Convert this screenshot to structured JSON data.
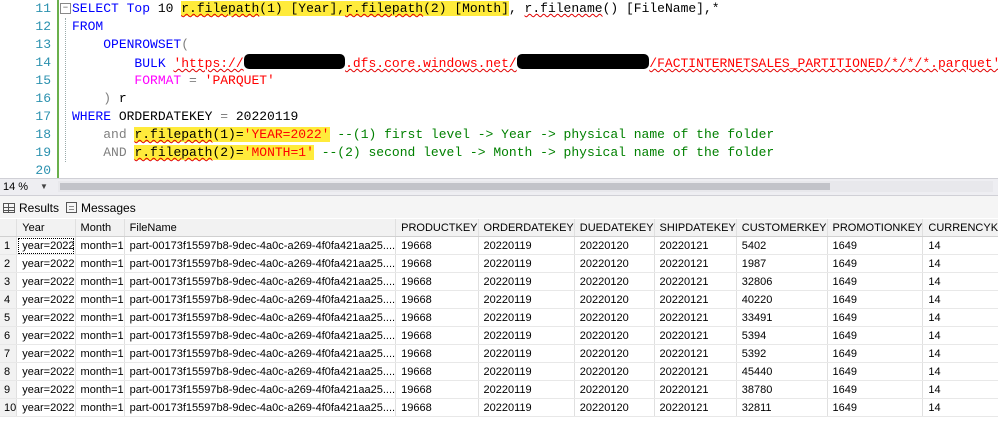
{
  "editor": {
    "lines": [
      {
        "num": "11",
        "parts": [
          {
            "t": "SELECT",
            "c": "kw"
          },
          {
            "t": " "
          },
          {
            "t": "Top",
            "c": "kw"
          },
          {
            "t": " 10 "
          },
          {
            "t": "r.filepath",
            "c": "hl sq"
          },
          {
            "t": "(1) [Year],",
            "c": "hl"
          },
          {
            "t": "r.filepath",
            "c": "hl sq"
          },
          {
            "t": "(2) [Month]",
            "c": "hl"
          },
          {
            "t": ", "
          },
          {
            "t": "r.filename",
            "c": "sq"
          },
          {
            "t": "() [FileName],*"
          }
        ]
      },
      {
        "num": "12",
        "parts": [
          {
            "t": "FROM",
            "c": "kw"
          }
        ]
      },
      {
        "num": "13",
        "parts": [
          {
            "t": "    "
          },
          {
            "t": "OPENROWSET",
            "c": "kw"
          },
          {
            "t": "(",
            "c": "gray"
          }
        ]
      },
      {
        "num": "14",
        "parts": [
          {
            "t": "        "
          },
          {
            "t": "BULK",
            "c": "kw"
          },
          {
            "t": " "
          },
          {
            "t": "'https://",
            "c": "str sq"
          },
          {
            "t": "",
            "redact": 13
          },
          {
            "t": ".dfs.core.windows.net/",
            "c": "str sq"
          },
          {
            "t": "",
            "redact": 17
          },
          {
            "t": "/FACTINTERNETSALES_PARTITIONED/*/*/*.parquet'",
            "c": "str sq"
          },
          {
            "t": ",",
            "c": "gray"
          }
        ]
      },
      {
        "num": "15",
        "parts": [
          {
            "t": "        "
          },
          {
            "t": "FORMAT",
            "c": "fn"
          },
          {
            "t": " = ",
            "c": "gray"
          },
          {
            "t": "'PARQUET'",
            "c": "str"
          }
        ]
      },
      {
        "num": "16",
        "parts": [
          {
            "t": "    "
          },
          {
            "t": ")",
            "c": "gray"
          },
          {
            "t": " r"
          }
        ]
      },
      {
        "num": "17",
        "parts": [
          {
            "t": "WHERE",
            "c": "kw"
          },
          {
            "t": " ORDERDATEKEY "
          },
          {
            "t": "=",
            "c": "gray"
          },
          {
            "t": " 20220119"
          }
        ]
      },
      {
        "num": "18",
        "parts": [
          {
            "t": "    "
          },
          {
            "t": "and",
            "c": "gray"
          },
          {
            "t": " "
          },
          {
            "t": "r.filepath",
            "c": "hl sq"
          },
          {
            "t": "(1)=",
            "c": "hl"
          },
          {
            "t": "'YEAR=2022'",
            "c": "hl str"
          },
          {
            "t": " "
          },
          {
            "t": "--(1) first level -> Year -> physical name of the folder",
            "c": "cmt"
          }
        ]
      },
      {
        "num": "19",
        "parts": [
          {
            "t": "    "
          },
          {
            "t": "AND",
            "c": "gray"
          },
          {
            "t": " "
          },
          {
            "t": "r.filepath",
            "c": "hl sq"
          },
          {
            "t": "(2)=",
            "c": "hl"
          },
          {
            "t": "'MONTH=1'",
            "c": "hl str"
          },
          {
            "t": " "
          },
          {
            "t": "--(2) second level -> Month -> physical name of the folder",
            "c": "cmt"
          }
        ]
      },
      {
        "num": "20",
        "parts": []
      }
    ]
  },
  "zoom": {
    "value": "14 %"
  },
  "tabs": {
    "results": "Results",
    "messages": "Messages"
  },
  "grid": {
    "columns": [
      "",
      "Year",
      "Month",
      "FileName",
      "PRODUCTKEY",
      "ORDERDATEKEY",
      "DUEDATEKEY",
      "SHIPDATEKEY",
      "CUSTOMERKEY",
      "PROMOTIONKEY",
      "CURRENCYKEY"
    ],
    "rows": [
      [
        "1",
        "year=2022",
        "month=1",
        "part-00173f15597b8-9dec-4a0c-a269-4f0fa421aa25....",
        "19668",
        "20220119",
        "20220120",
        "20220121",
        "5402",
        "1649",
        "14"
      ],
      [
        "2",
        "year=2022",
        "month=1",
        "part-00173f15597b8-9dec-4a0c-a269-4f0fa421aa25....",
        "19668",
        "20220119",
        "20220120",
        "20220121",
        "1987",
        "1649",
        "14"
      ],
      [
        "3",
        "year=2022",
        "month=1",
        "part-00173f15597b8-9dec-4a0c-a269-4f0fa421aa25....",
        "19668",
        "20220119",
        "20220120",
        "20220121",
        "32806",
        "1649",
        "14"
      ],
      [
        "4",
        "year=2022",
        "month=1",
        "part-00173f15597b8-9dec-4a0c-a269-4f0fa421aa25....",
        "19668",
        "20220119",
        "20220120",
        "20220121",
        "40220",
        "1649",
        "14"
      ],
      [
        "5",
        "year=2022",
        "month=1",
        "part-00173f15597b8-9dec-4a0c-a269-4f0fa421aa25....",
        "19668",
        "20220119",
        "20220120",
        "20220121",
        "33491",
        "1649",
        "14"
      ],
      [
        "6",
        "year=2022",
        "month=1",
        "part-00173f15597b8-9dec-4a0c-a269-4f0fa421aa25....",
        "19668",
        "20220119",
        "20220120",
        "20220121",
        "5394",
        "1649",
        "14"
      ],
      [
        "7",
        "year=2022",
        "month=1",
        "part-00173f15597b8-9dec-4a0c-a269-4f0fa421aa25....",
        "19668",
        "20220119",
        "20220120",
        "20220121",
        "5392",
        "1649",
        "14"
      ],
      [
        "8",
        "year=2022",
        "month=1",
        "part-00173f15597b8-9dec-4a0c-a269-4f0fa421aa25....",
        "19668",
        "20220119",
        "20220120",
        "20220121",
        "45440",
        "1649",
        "14"
      ],
      [
        "9",
        "year=2022",
        "month=1",
        "part-00173f15597b8-9dec-4a0c-a269-4f0fa421aa25....",
        "19668",
        "20220119",
        "20220120",
        "20220121",
        "38780",
        "1649",
        "14"
      ],
      [
        "10",
        "year=2022",
        "month=1",
        "part-00173f15597b8-9dec-4a0c-a269-4f0fa421aa25....",
        "19668",
        "20220119",
        "20220120",
        "20220121",
        "32811",
        "1649",
        "14"
      ]
    ]
  }
}
